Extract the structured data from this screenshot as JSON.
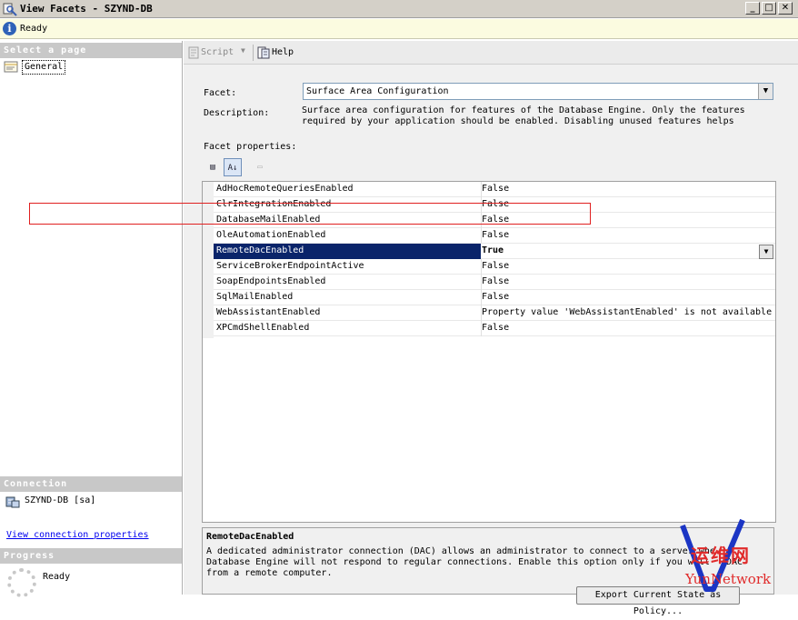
{
  "window": {
    "title": "View Facets - SZYND-DB",
    "minimize_glyph": "_",
    "maximize_glyph": "□",
    "close_glyph": "✕"
  },
  "status_bar": {
    "icon": "info-icon",
    "icon_glyph": "i",
    "text": "Ready"
  },
  "left_pane": {
    "select_page": {
      "header": "Select a page",
      "items": [
        {
          "label": "General",
          "icon": "page-icon"
        }
      ]
    },
    "connection": {
      "header": "Connection",
      "server": "SZYND-DB [sa]",
      "link": "View connection properties"
    },
    "progress": {
      "header": "Progress",
      "status": "Ready"
    }
  },
  "toolbar": {
    "script_label": "Script",
    "script_arrow": "▼",
    "help_label": "Help"
  },
  "facet": {
    "label": "Facet:",
    "selected": "Surface Area Configuration",
    "dropdown_glyph": "▼",
    "description_label": "Description:",
    "description_lines": [
      "Surface area configuration for features of the Database Engine. Only the features",
      "required by your application should be enabled. Disabling unused features helps"
    ],
    "properties_label": "Facet properties:"
  },
  "grid_toolbar": {
    "categorized_glyph": "▤",
    "alphabetical_glyph": "A↓",
    "pages_glyph": "▭"
  },
  "properties": [
    {
      "name": "AdHocRemoteQueriesEnabled",
      "value": "False"
    },
    {
      "name": "ClrIntegrationEnabled",
      "value": "False"
    },
    {
      "name": "DatabaseMailEnabled",
      "value": "False"
    },
    {
      "name": "OleAutomationEnabled",
      "value": "False"
    },
    {
      "name": "RemoteDacEnabled",
      "value": "True",
      "selected": true
    },
    {
      "name": "ServiceBrokerEndpointActive",
      "value": "False"
    },
    {
      "name": "SoapEndpointsEnabled",
      "value": "False"
    },
    {
      "name": "SqlMailEnabled",
      "value": "False"
    },
    {
      "name": "WebAssistantEnabled",
      "value": "Property value 'WebAssistantEnabled' is not available"
    },
    {
      "name": "XPCmdShellEnabled",
      "value": "False"
    }
  ],
  "value_dropdown_glyph": "▼",
  "description_panel": {
    "title": "RemoteDacEnabled",
    "text": "A dedicated administrator connection (DAC) allows an administrator to connect to a server whe\nDatabase Engine will not respond to regular connections. Enable this option only if you will   DAC\nfrom a remote computer."
  },
  "export_button": "Export Current State as Policy...",
  "watermark": {
    "chinese": "运维网",
    "english": "YunNetwork",
    "accent_color": "#e02a2a",
    "v_color": "#1b35c4"
  },
  "colors": {
    "selection": "#0a246a",
    "highlight_box": "#e02020",
    "link": "#0000ee"
  }
}
